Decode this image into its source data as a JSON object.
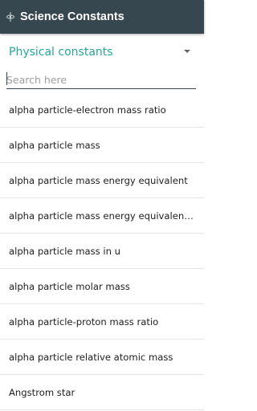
{
  "app": {
    "title": "Science Constants",
    "icon": "atom-icon",
    "colors": {
      "appbar": "#37474f",
      "accent": "#26a69a"
    }
  },
  "category_select": {
    "selected": "Physical constants"
  },
  "search": {
    "placeholder": "Search here",
    "value": ""
  },
  "constants": [
    "alpha particle-electron mass ratio",
    "alpha particle mass",
    "alpha particle mass energy equivalent",
    "alpha particle mass energy equivalent in MeV",
    "alpha particle mass in u",
    "alpha particle molar mass",
    "alpha particle-proton mass ratio",
    "alpha particle relative atomic mass",
    "Angstrom star"
  ]
}
